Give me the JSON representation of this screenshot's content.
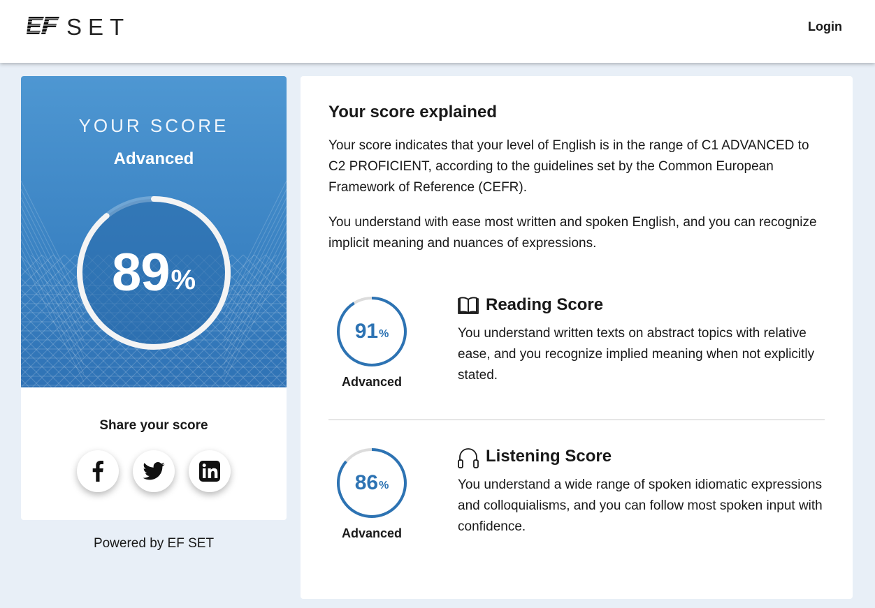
{
  "header": {
    "logo_text": "SET",
    "logo_mark": "EF",
    "login_label": "Login"
  },
  "score_card": {
    "heading": "YOUR SCORE",
    "level": "Advanced",
    "score_value": "89",
    "score_unit": "%",
    "score_fraction": 0.89,
    "share_label": "Share your score",
    "social": [
      {
        "name": "facebook",
        "icon": "facebook-icon"
      },
      {
        "name": "twitter",
        "icon": "twitter-icon"
      },
      {
        "name": "linkedin",
        "icon": "linkedin-icon"
      }
    ],
    "powered_by": "Powered by EF SET"
  },
  "explained": {
    "title": "Your score explained",
    "paragraph1": "Your score indicates that your level of English is in the range of C1 ADVANCED to C2 PROFICIENT, according to the guidelines set by the Common European Framework of Reference (CEFR).",
    "paragraph2": "You understand with ease most written and spoken English, and you can recognize implicit meaning and nuances of expressions."
  },
  "skills": [
    {
      "title": "Reading Score",
      "icon": "book-icon",
      "score_value": "91",
      "score_unit": "%",
      "score_fraction": 0.91,
      "level": "Advanced",
      "description": "You understand written texts on abstract topics with relative ease, and you recognize implied meaning when not explicitly stated."
    },
    {
      "title": "Listening Score",
      "icon": "headphones-icon",
      "score_value": "86",
      "score_unit": "%",
      "score_fraction": 0.86,
      "level": "Advanced",
      "description": "You understand a wide range of spoken idiomatic expressions and colloquialisms, and you can follow most spoken input with confidence."
    }
  ],
  "colors": {
    "accent_blue": "#2d73b3",
    "panel_top": "#4e97d2",
    "panel_bottom": "#2f72b5",
    "page_background": "#e8eff7"
  }
}
